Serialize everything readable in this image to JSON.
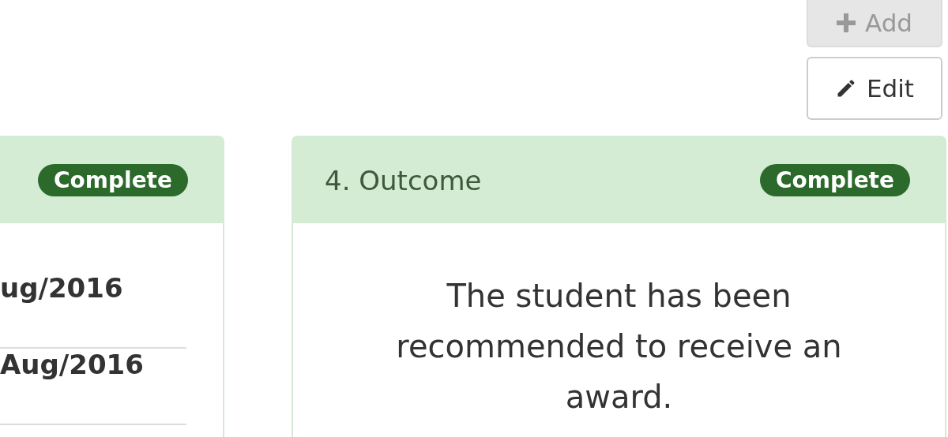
{
  "toolbar": {
    "buttons": [
      {
        "kind": "add",
        "label": "Add",
        "disabled": true
      },
      {
        "kind": "edit",
        "label": "Edit",
        "disabled": false
      }
    ]
  },
  "cards": [
    {
      "kind": "rows",
      "status": {
        "label": "Complete",
        "kind": "complete"
      },
      "rows": [
        "ug/2016",
        "Aug/2016"
      ]
    },
    {
      "kind": "text",
      "title": "4. Outcome",
      "status": {
        "label": "Complete",
        "kind": "complete"
      },
      "text": "The student has been recommended to receive an award."
    }
  ]
}
